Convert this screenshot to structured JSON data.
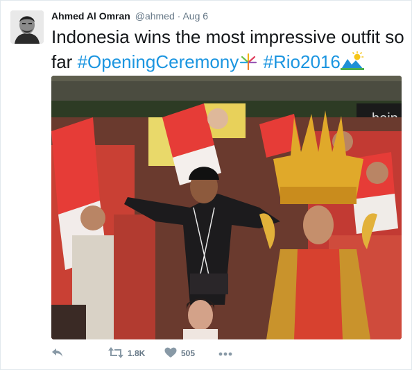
{
  "tweet": {
    "author_name": "Ahmed Al Omran",
    "author_handle": "@ahmed",
    "separator": "·",
    "date": "Aug 6",
    "text_plain": "Indonesia wins the most impressive outfit so far ",
    "hashtags": [
      "#OpeningCeremony",
      "#Rio2016"
    ],
    "media_logo_text": "bein",
    "actions": {
      "reply_icon": "reply-icon",
      "retweet_icon": "retweet-icon",
      "retweet_count": "1.8K",
      "like_icon": "heart-icon",
      "like_count": "505",
      "more_icon": "more-icon"
    },
    "colors": {
      "hashtag": "#1b95e0",
      "action": "#8899a6",
      "text": "#14171a",
      "muted": "#657786"
    }
  }
}
